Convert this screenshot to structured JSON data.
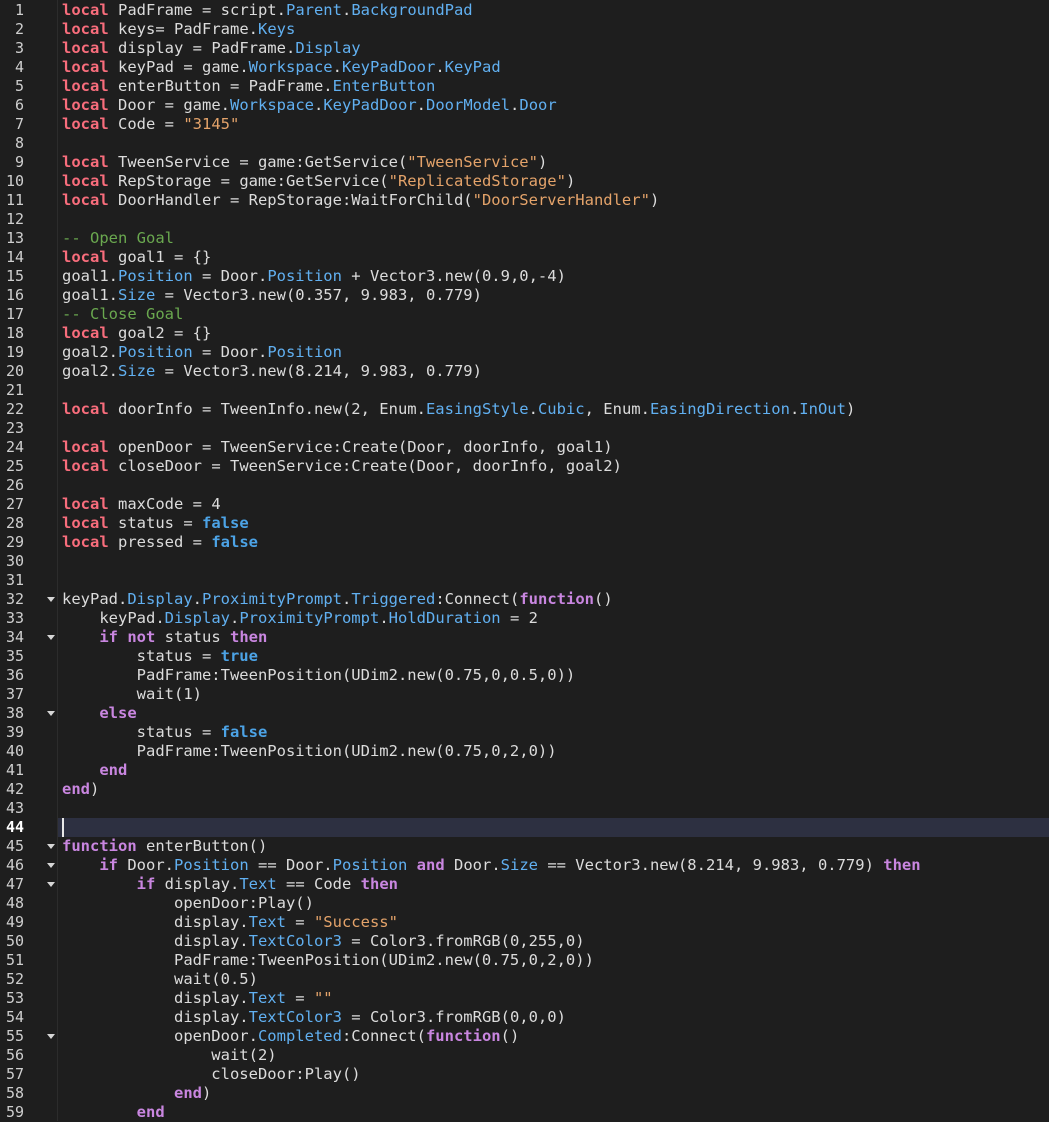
{
  "editor": {
    "current_line": 44,
    "lines": [
      {
        "n": "1",
        "fold": false,
        "tokens": [
          [
            "k",
            "local"
          ],
          [
            "t",
            " PadFrame = script."
          ],
          [
            "p",
            "Parent"
          ],
          [
            "t",
            "."
          ],
          [
            "p",
            "BackgroundPad"
          ]
        ]
      },
      {
        "n": "2",
        "fold": false,
        "tokens": [
          [
            "k",
            "local"
          ],
          [
            "t",
            " keys= PadFrame."
          ],
          [
            "p",
            "Keys"
          ]
        ]
      },
      {
        "n": "3",
        "fold": false,
        "tokens": [
          [
            "k",
            "local"
          ],
          [
            "t",
            " display = PadFrame."
          ],
          [
            "p",
            "Display"
          ]
        ]
      },
      {
        "n": "4",
        "fold": false,
        "tokens": [
          [
            "k",
            "local"
          ],
          [
            "t",
            " keyPad = game."
          ],
          [
            "p",
            "Workspace"
          ],
          [
            "t",
            "."
          ],
          [
            "p",
            "KeyPadDoor"
          ],
          [
            "t",
            "."
          ],
          [
            "p",
            "KeyPad"
          ]
        ]
      },
      {
        "n": "5",
        "fold": false,
        "tokens": [
          [
            "k",
            "local"
          ],
          [
            "t",
            " enterButton = PadFrame."
          ],
          [
            "p",
            "EnterButton"
          ]
        ]
      },
      {
        "n": "6",
        "fold": false,
        "tokens": [
          [
            "k",
            "local"
          ],
          [
            "t",
            " Door = game."
          ],
          [
            "p",
            "Workspace"
          ],
          [
            "t",
            "."
          ],
          [
            "p",
            "KeyPadDoor"
          ],
          [
            "t",
            "."
          ],
          [
            "p",
            "DoorModel"
          ],
          [
            "t",
            "."
          ],
          [
            "p",
            "Door"
          ]
        ]
      },
      {
        "n": "7",
        "fold": false,
        "tokens": [
          [
            "k",
            "local"
          ],
          [
            "t",
            " Code = "
          ],
          [
            "s",
            "\"3145\""
          ]
        ]
      },
      {
        "n": "8",
        "fold": false,
        "tokens": []
      },
      {
        "n": "9",
        "fold": false,
        "tokens": [
          [
            "k",
            "local"
          ],
          [
            "t",
            " TweenService = game:GetService("
          ],
          [
            "s",
            "\"TweenService\""
          ],
          [
            "t",
            ")"
          ]
        ]
      },
      {
        "n": "10",
        "fold": false,
        "tokens": [
          [
            "k",
            "local"
          ],
          [
            "t",
            " RepStorage = game:GetService("
          ],
          [
            "s",
            "\"ReplicatedStorage\""
          ],
          [
            "t",
            ")"
          ]
        ]
      },
      {
        "n": "11",
        "fold": false,
        "tokens": [
          [
            "k",
            "local"
          ],
          [
            "t",
            " DoorHandler = RepStorage:WaitForChild("
          ],
          [
            "s",
            "\"DoorServerHandler\""
          ],
          [
            "t",
            ")"
          ]
        ]
      },
      {
        "n": "12",
        "fold": false,
        "tokens": []
      },
      {
        "n": "13",
        "fold": false,
        "tokens": [
          [
            "c",
            "-- Open Goal"
          ]
        ]
      },
      {
        "n": "14",
        "fold": false,
        "tokens": [
          [
            "k",
            "local"
          ],
          [
            "t",
            " goal1 = {}"
          ]
        ]
      },
      {
        "n": "15",
        "fold": false,
        "tokens": [
          [
            "t",
            "goal1."
          ],
          [
            "p",
            "Position"
          ],
          [
            "t",
            " = Door."
          ],
          [
            "p",
            "Position"
          ],
          [
            "t",
            " + Vector3.new(0.9,0,-4)"
          ]
        ]
      },
      {
        "n": "16",
        "fold": false,
        "tokens": [
          [
            "t",
            "goal1."
          ],
          [
            "p",
            "Size"
          ],
          [
            "t",
            " = Vector3.new(0.357, 9.983, 0.779)"
          ]
        ]
      },
      {
        "n": "17",
        "fold": false,
        "tokens": [
          [
            "c",
            "-- Close Goal"
          ]
        ]
      },
      {
        "n": "18",
        "fold": false,
        "tokens": [
          [
            "k",
            "local"
          ],
          [
            "t",
            " goal2 = {}"
          ]
        ]
      },
      {
        "n": "19",
        "fold": false,
        "tokens": [
          [
            "t",
            "goal2."
          ],
          [
            "p",
            "Position"
          ],
          [
            "t",
            " = Door."
          ],
          [
            "p",
            "Position"
          ]
        ]
      },
      {
        "n": "20",
        "fold": false,
        "tokens": [
          [
            "t",
            "goal2."
          ],
          [
            "p",
            "Size"
          ],
          [
            "t",
            " = Vector3.new(8.214, 9.983, 0.779)"
          ]
        ]
      },
      {
        "n": "21",
        "fold": false,
        "tokens": []
      },
      {
        "n": "22",
        "fold": false,
        "tokens": [
          [
            "k",
            "local"
          ],
          [
            "t",
            " doorInfo = TweenInfo.new(2, Enum."
          ],
          [
            "p",
            "EasingStyle"
          ],
          [
            "t",
            "."
          ],
          [
            "p",
            "Cubic"
          ],
          [
            "t",
            ", Enum."
          ],
          [
            "p",
            "EasingDirection"
          ],
          [
            "t",
            "."
          ],
          [
            "p",
            "InOut"
          ],
          [
            "t",
            ")"
          ]
        ]
      },
      {
        "n": "23",
        "fold": false,
        "tokens": []
      },
      {
        "n": "24",
        "fold": false,
        "tokens": [
          [
            "k",
            "local"
          ],
          [
            "t",
            " openDoor = TweenService:Create(Door, doorInfo, goal1)"
          ]
        ]
      },
      {
        "n": "25",
        "fold": false,
        "tokens": [
          [
            "k",
            "local"
          ],
          [
            "t",
            " closeDoor = TweenService:Create(Door, doorInfo, goal2)"
          ]
        ]
      },
      {
        "n": "26",
        "fold": false,
        "tokens": []
      },
      {
        "n": "27",
        "fold": false,
        "tokens": [
          [
            "k",
            "local"
          ],
          [
            "t",
            " maxCode = 4"
          ]
        ]
      },
      {
        "n": "28",
        "fold": false,
        "tokens": [
          [
            "k",
            "local"
          ],
          [
            "t",
            " status = "
          ],
          [
            "l",
            "false"
          ]
        ]
      },
      {
        "n": "29",
        "fold": false,
        "tokens": [
          [
            "k",
            "local"
          ],
          [
            "t",
            " pressed = "
          ],
          [
            "l",
            "false"
          ]
        ]
      },
      {
        "n": "30",
        "fold": false,
        "tokens": []
      },
      {
        "n": "31",
        "fold": false,
        "tokens": []
      },
      {
        "n": "32",
        "fold": true,
        "tokens": [
          [
            "t",
            "keyPad."
          ],
          [
            "p",
            "Display"
          ],
          [
            "t",
            "."
          ],
          [
            "p",
            "ProximityPrompt"
          ],
          [
            "t",
            "."
          ],
          [
            "p",
            "Triggered"
          ],
          [
            "t",
            ":Connect("
          ],
          [
            "b",
            "function"
          ],
          [
            "t",
            "()"
          ]
        ]
      },
      {
        "n": "33",
        "fold": false,
        "tokens": [
          [
            "t",
            "    keyPad."
          ],
          [
            "p",
            "Display"
          ],
          [
            "t",
            "."
          ],
          [
            "p",
            "ProximityPrompt"
          ],
          [
            "t",
            "."
          ],
          [
            "p",
            "HoldDuration"
          ],
          [
            "t",
            " = 2"
          ]
        ]
      },
      {
        "n": "34",
        "fold": true,
        "tokens": [
          [
            "t",
            "    "
          ],
          [
            "b",
            "if not"
          ],
          [
            "t",
            " status "
          ],
          [
            "b",
            "then"
          ]
        ]
      },
      {
        "n": "35",
        "fold": false,
        "tokens": [
          [
            "t",
            "        status = "
          ],
          [
            "l",
            "true"
          ]
        ]
      },
      {
        "n": "36",
        "fold": false,
        "tokens": [
          [
            "t",
            "        PadFrame:TweenPosition(UDim2.new(0.75,0,0.5,0))"
          ]
        ]
      },
      {
        "n": "37",
        "fold": false,
        "tokens": [
          [
            "t",
            "        wait(1)"
          ]
        ]
      },
      {
        "n": "38",
        "fold": true,
        "tokens": [
          [
            "t",
            "    "
          ],
          [
            "b",
            "else"
          ]
        ]
      },
      {
        "n": "39",
        "fold": false,
        "tokens": [
          [
            "t",
            "        status = "
          ],
          [
            "l",
            "false"
          ]
        ]
      },
      {
        "n": "40",
        "fold": false,
        "tokens": [
          [
            "t",
            "        PadFrame:TweenPosition(UDim2.new(0.75,0,2,0))"
          ]
        ]
      },
      {
        "n": "41",
        "fold": false,
        "tokens": [
          [
            "t",
            "    "
          ],
          [
            "b",
            "end"
          ]
        ]
      },
      {
        "n": "42",
        "fold": false,
        "tokens": [
          [
            "b",
            "end"
          ],
          [
            "t",
            ")"
          ]
        ]
      },
      {
        "n": "43",
        "fold": false,
        "tokens": []
      },
      {
        "n": "44",
        "fold": false,
        "tokens": []
      },
      {
        "n": "45",
        "fold": true,
        "tokens": [
          [
            "b",
            "function"
          ],
          [
            "t",
            " enterButton()"
          ]
        ]
      },
      {
        "n": "46",
        "fold": true,
        "tokens": [
          [
            "t",
            "    "
          ],
          [
            "b",
            "if"
          ],
          [
            "t",
            " Door."
          ],
          [
            "p",
            "Position"
          ],
          [
            "t",
            " == Door."
          ],
          [
            "p",
            "Position"
          ],
          [
            "t",
            " "
          ],
          [
            "b",
            "and"
          ],
          [
            "t",
            " Door."
          ],
          [
            "p",
            "Size"
          ],
          [
            "t",
            " == Vector3.new(8.214, 9.983, 0.779) "
          ],
          [
            "b",
            "then"
          ]
        ]
      },
      {
        "n": "47",
        "fold": true,
        "tokens": [
          [
            "t",
            "        "
          ],
          [
            "b",
            "if"
          ],
          [
            "t",
            " display."
          ],
          [
            "p",
            "Text"
          ],
          [
            "t",
            " == Code "
          ],
          [
            "b",
            "then"
          ]
        ]
      },
      {
        "n": "48",
        "fold": false,
        "tokens": [
          [
            "t",
            "            openDoor:Play()"
          ]
        ]
      },
      {
        "n": "49",
        "fold": false,
        "tokens": [
          [
            "t",
            "            display."
          ],
          [
            "p",
            "Text"
          ],
          [
            "t",
            " = "
          ],
          [
            "s",
            "\"Success\""
          ]
        ]
      },
      {
        "n": "50",
        "fold": false,
        "tokens": [
          [
            "t",
            "            display."
          ],
          [
            "p",
            "TextColor3"
          ],
          [
            "t",
            " = Color3.fromRGB(0,255,0)"
          ]
        ]
      },
      {
        "n": "51",
        "fold": false,
        "tokens": [
          [
            "t",
            "            PadFrame:TweenPosition(UDim2.new(0.75,0,2,0))"
          ]
        ]
      },
      {
        "n": "52",
        "fold": false,
        "tokens": [
          [
            "t",
            "            wait(0.5)"
          ]
        ]
      },
      {
        "n": "53",
        "fold": false,
        "tokens": [
          [
            "t",
            "            display."
          ],
          [
            "p",
            "Text"
          ],
          [
            "t",
            " = "
          ],
          [
            "s",
            "\"\""
          ]
        ]
      },
      {
        "n": "54",
        "fold": false,
        "tokens": [
          [
            "t",
            "            display."
          ],
          [
            "p",
            "TextColor3"
          ],
          [
            "t",
            " = Color3.fromRGB(0,0,0)"
          ]
        ]
      },
      {
        "n": "55",
        "fold": true,
        "tokens": [
          [
            "t",
            "            openDoor."
          ],
          [
            "p",
            "Completed"
          ],
          [
            "t",
            ":Connect("
          ],
          [
            "b",
            "function"
          ],
          [
            "t",
            "()"
          ]
        ]
      },
      {
        "n": "56",
        "fold": false,
        "tokens": [
          [
            "t",
            "                wait(2)"
          ]
        ]
      },
      {
        "n": "57",
        "fold": false,
        "tokens": [
          [
            "t",
            "                closeDoor:Play()"
          ]
        ]
      },
      {
        "n": "58",
        "fold": false,
        "tokens": [
          [
            "t",
            "            "
          ],
          [
            "b",
            "end"
          ],
          [
            "t",
            ")"
          ]
        ]
      },
      {
        "n": "59",
        "fold": false,
        "tokens": [
          [
            "t",
            "        "
          ],
          [
            "b",
            "end"
          ]
        ]
      }
    ]
  },
  "colors": {
    "background": "#1e1e1e",
    "current_line_background": "#2d3041",
    "keyword_local": "#f86d7c",
    "keyword_flow": "#c986e0",
    "literal_bool": "#4ca3e6",
    "string": "#e4a36a",
    "comment": "#6aa84f",
    "property": "#61b0f1",
    "text": "#dcdcdc"
  }
}
